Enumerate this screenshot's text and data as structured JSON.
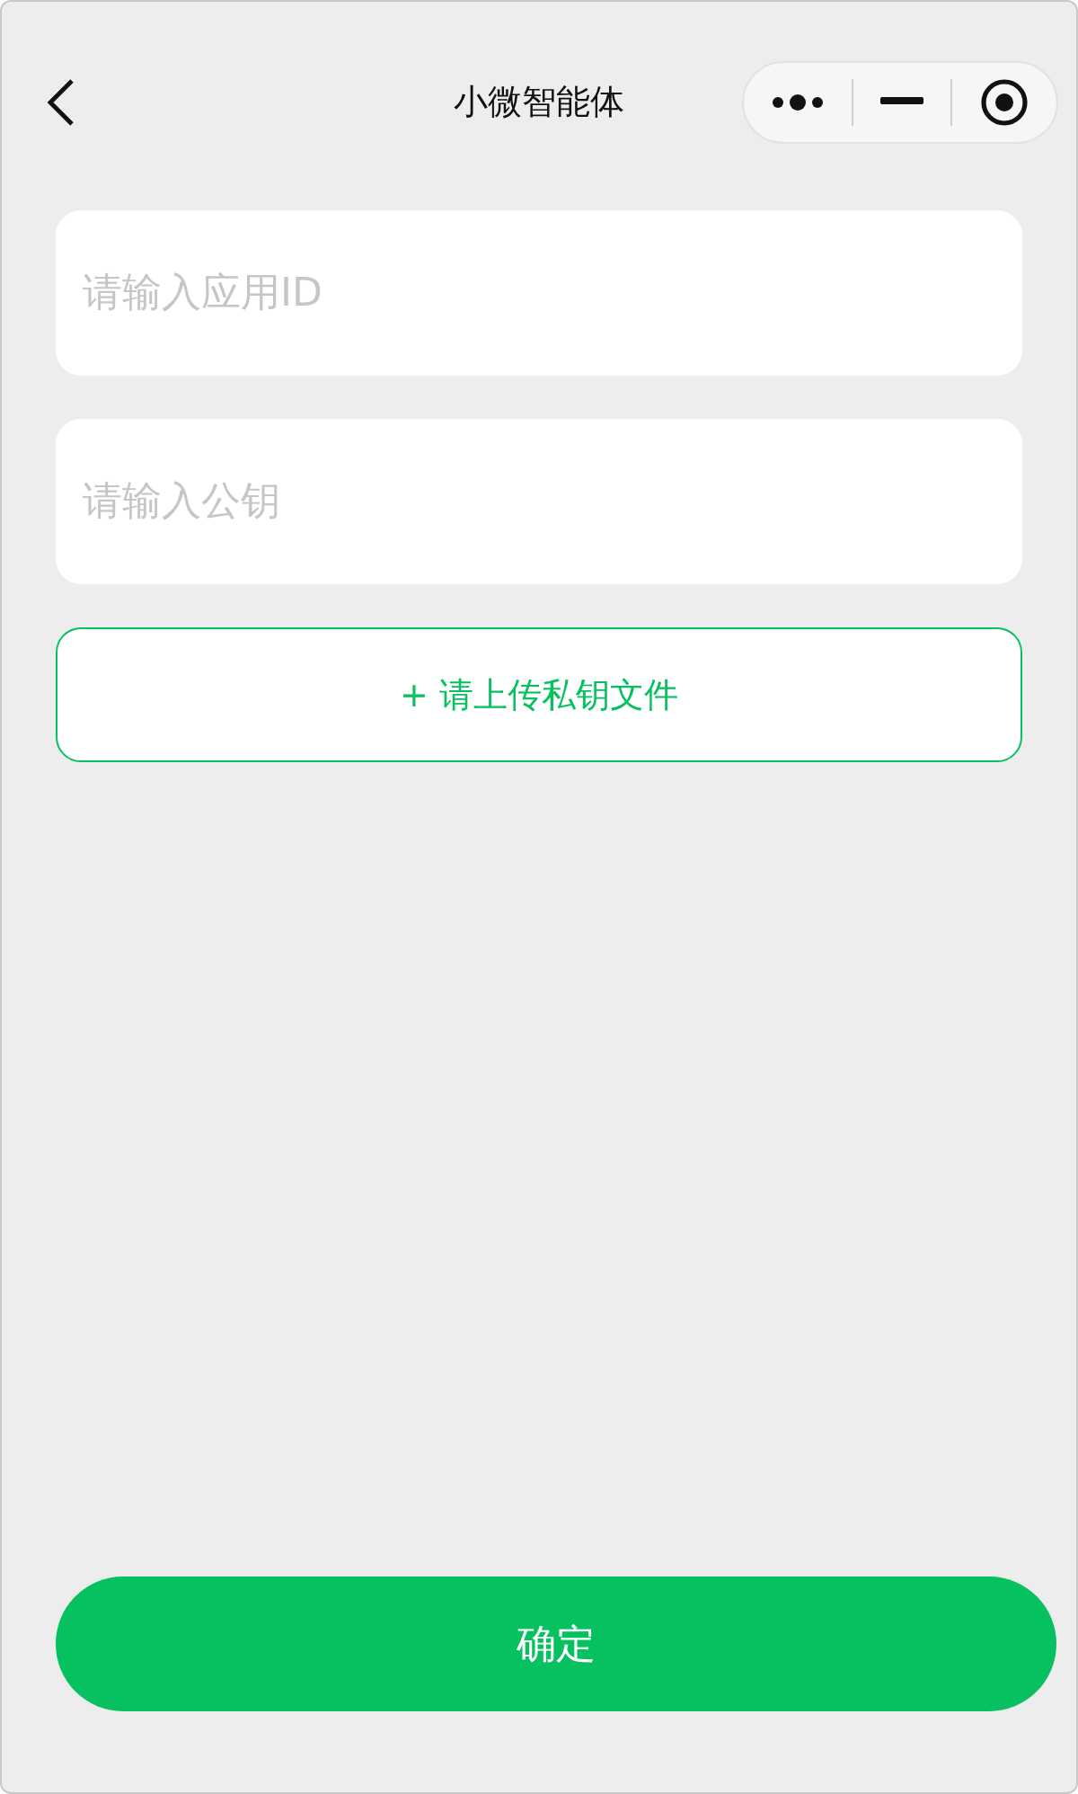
{
  "navigation_bar": {
    "title": "小微智能体"
  },
  "fields": [
    {
      "placeholder": "请输入应用ID"
    },
    {
      "placeholder": "请输入公钥"
    }
  ],
  "upload_button": {
    "label": "+ 请上传私钥文件"
  },
  "confirm_button": {
    "label": "确定"
  }
}
